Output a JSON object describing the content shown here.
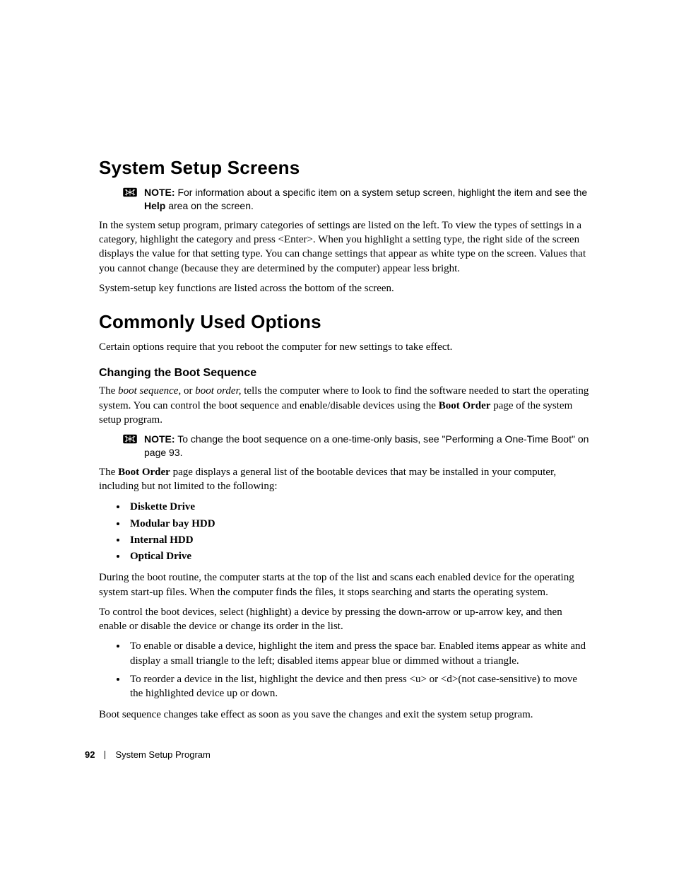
{
  "headings": {
    "h1_a": "System Setup Screens",
    "h1_b": "Commonly Used Options",
    "h3_a": "Changing the Boot Sequence"
  },
  "notes": {
    "label": "NOTE:",
    "n1_text": " For information about a specific item on a system setup screen, highlight the item and see the ",
    "n1_bold": "Help",
    "n1_tail": " area on the screen.",
    "n2_text": " To change the boot sequence on a one-time-only basis, see \"Performing a One-Time Boot\" on page 93."
  },
  "para": {
    "p1": "In the system setup program, primary categories of settings are listed on the left. To view the types of settings in a category, highlight the category and press <Enter>. When you highlight a setting type, the right side of the screen displays the value for that setting type. You can change settings that appear as white type on the screen. Values that you cannot change (because they are determined by the computer) appear less bright.",
    "p2": "System-setup key functions are listed across the bottom of the screen.",
    "p3": "Certain options require that you reboot the computer for new settings to take effect.",
    "p4_a": "The ",
    "p4_i1": "boot sequence,",
    "p4_b": " or ",
    "p4_i2": "boot order,",
    "p4_c": " tells the computer where to look to find the software needed to start the operating system. You can control the boot sequence and enable/disable devices using the ",
    "p4_bold": "Boot Order",
    "p4_d": " page of the system setup program.",
    "p5_a": "The ",
    "p5_bold": "Boot Order",
    "p5_b": " page displays a general list of the bootable devices that may be installed in your computer, including but not limited to the following:",
    "p6": "During the boot routine, the computer starts at the top of the list and scans each enabled device for the operating system start-up files. When the computer finds the files, it stops searching and starts the operating system.",
    "p7": "To control the boot devices, select (highlight) a device by pressing the down-arrow or up-arrow key, and then enable or disable the device or change its order in the list.",
    "p8": "Boot sequence changes take effect as soon as you save the changes and exit the system setup program."
  },
  "devices": [
    "Diskette Drive",
    "Modular bay HDD",
    "Internal HDD",
    "Optical Drive"
  ],
  "instructions": [
    "To enable or disable a device, highlight the item and press the space bar. Enabled items appear as white and display a small triangle to the left; disabled items appear blue or dimmed without a triangle.",
    "To reorder a device in the list, highlight the device and then press <u> or <d>(not case-sensitive) to move the highlighted device up or down."
  ],
  "footer": {
    "page": "92",
    "section": "System Setup Program"
  }
}
